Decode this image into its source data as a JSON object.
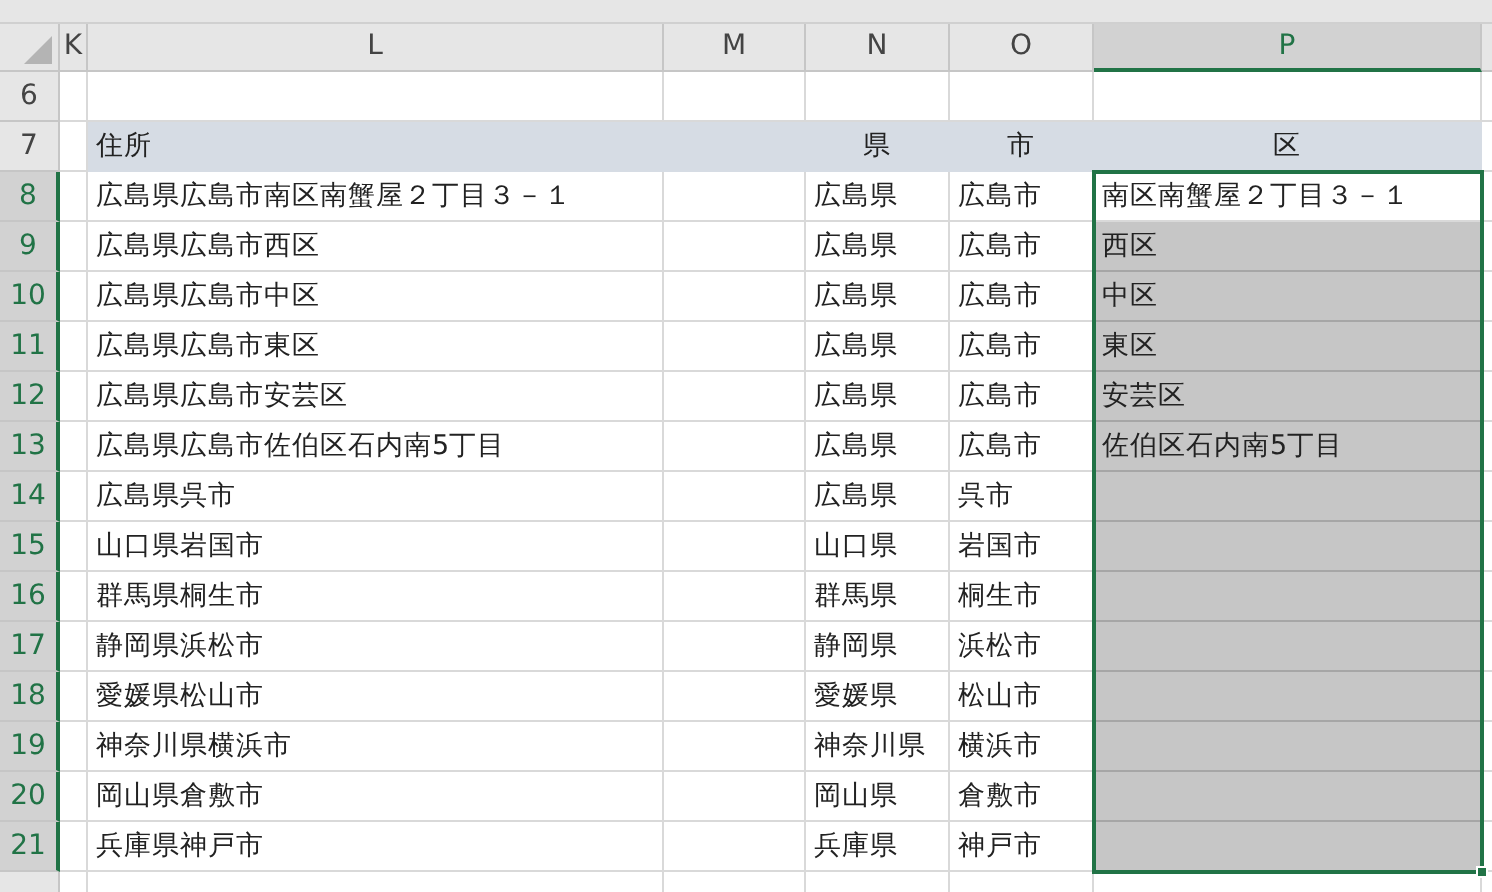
{
  "columns": [
    {
      "label": "K",
      "selected": false
    },
    {
      "label": "L",
      "selected": false
    },
    {
      "label": "M",
      "selected": false
    },
    {
      "label": "N",
      "selected": false
    },
    {
      "label": "O",
      "selected": false
    },
    {
      "label": "P",
      "selected": true
    }
  ],
  "rows": [
    {
      "number": "6",
      "kind": "blank",
      "selected": false
    },
    {
      "number": "7",
      "kind": "header",
      "selected": false,
      "address": "住所",
      "prefecture": "県",
      "city": "市",
      "ward": "区"
    },
    {
      "number": "8",
      "kind": "data",
      "selected": true,
      "active": true,
      "address": "広島県広島市南区南蟹屋２丁目３－１",
      "prefecture": "広島県",
      "city": "広島市",
      "ward": "南区南蟹屋２丁目３－１"
    },
    {
      "number": "9",
      "kind": "data",
      "selected": true,
      "active": false,
      "address": "広島県広島市西区",
      "prefecture": "広島県",
      "city": "広島市",
      "ward": "西区"
    },
    {
      "number": "10",
      "kind": "data",
      "selected": true,
      "active": false,
      "address": "広島県広島市中区",
      "prefecture": "広島県",
      "city": "広島市",
      "ward": "中区"
    },
    {
      "number": "11",
      "kind": "data",
      "selected": true,
      "active": false,
      "address": "広島県広島市東区",
      "prefecture": "広島県",
      "city": "広島市",
      "ward": "東区"
    },
    {
      "number": "12",
      "kind": "data",
      "selected": true,
      "active": false,
      "address": "広島県広島市安芸区",
      "prefecture": "広島県",
      "city": "広島市",
      "ward": "安芸区"
    },
    {
      "number": "13",
      "kind": "data",
      "selected": true,
      "active": false,
      "address": "広島県広島市佐伯区石内南5丁目",
      "prefecture": "広島県",
      "city": "広島市",
      "ward": "佐伯区石内南5丁目"
    },
    {
      "number": "14",
      "kind": "data",
      "selected": true,
      "active": false,
      "address": "広島県呉市",
      "prefecture": "広島県",
      "city": "呉市"
    },
    {
      "number": "15",
      "kind": "data",
      "selected": true,
      "active": false,
      "address": "山口県岩国市",
      "prefecture": "山口県",
      "city": "岩国市"
    },
    {
      "number": "16",
      "kind": "data",
      "selected": true,
      "active": false,
      "address": "群馬県桐生市",
      "prefecture": "群馬県",
      "city": "桐生市"
    },
    {
      "number": "17",
      "kind": "data",
      "selected": true,
      "active": false,
      "address": "静岡県浜松市",
      "prefecture": "静岡県",
      "city": "浜松市"
    },
    {
      "number": "18",
      "kind": "data",
      "selected": true,
      "active": false,
      "address": "愛媛県松山市",
      "prefecture": "愛媛県",
      "city": "松山市"
    },
    {
      "number": "19",
      "kind": "data",
      "selected": true,
      "active": false,
      "address": "神奈川県横浜市",
      "prefecture": "神奈川県",
      "city": "横浜市"
    },
    {
      "number": "20",
      "kind": "data",
      "selected": true,
      "active": false,
      "address": "岡山県倉敷市",
      "prefecture": "岡山県",
      "city": "倉敷市"
    },
    {
      "number": "21",
      "kind": "data",
      "selected": true,
      "active": false,
      "address": "兵庫県神戸市",
      "prefecture": "兵庫県",
      "city": "神戸市"
    }
  ]
}
